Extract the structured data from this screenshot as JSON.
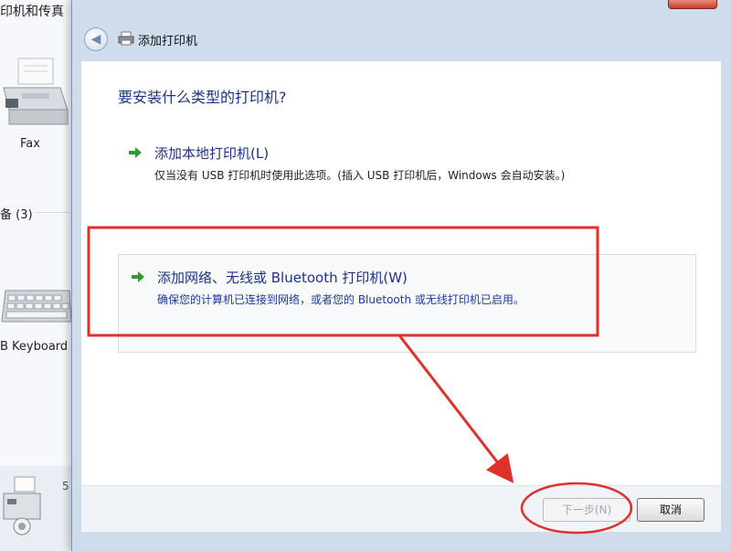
{
  "background": {
    "window_title": "印机和传真",
    "items": [
      {
        "label": "Fax"
      },
      {
        "label": "备 (3)"
      },
      {
        "label": "B Keyboard"
      }
    ],
    "bottom_text": "5"
  },
  "dialog": {
    "title": "添加打印机",
    "question": "要安装什么类型的打印机?",
    "options": [
      {
        "title": "添加本地打印机(L)",
        "description": "仅当没有 USB 打印机时使用此选项。(插入 USB 打印机后，Windows 会自动安装。)",
        "icon": "green-arrow-icon"
      },
      {
        "title": "添加网络、无线或 Bluetooth 打印机(W)",
        "description": "确保您的计算机已连接到网络，或者您的 Bluetooth 或无线打印机已启用。",
        "icon": "green-arrow-icon",
        "highlighted": true
      }
    ],
    "buttons": {
      "next": "下一步(N)",
      "cancel": "取消"
    }
  },
  "colors": {
    "annotation": "#e0302a",
    "heading_blue": "#1e3287",
    "arrow_green": "#2e9b32"
  }
}
